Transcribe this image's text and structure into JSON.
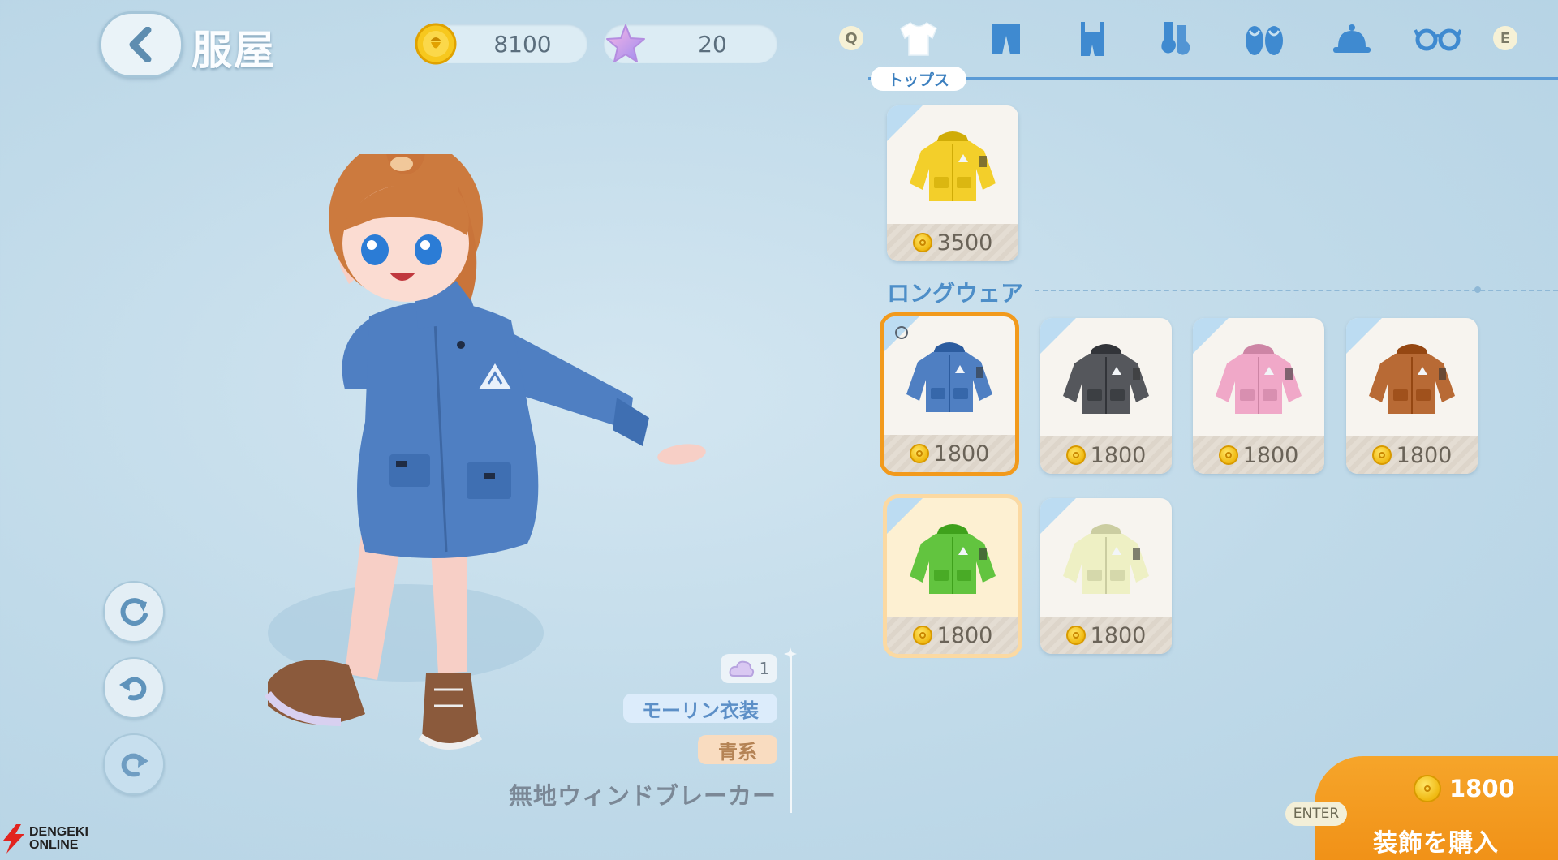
{
  "header": {
    "title": "服屋",
    "coins": "8100",
    "stars": "20"
  },
  "categories": {
    "prev_key": "Q",
    "next_key": "E",
    "active_label": "トップス",
    "icons": [
      "tshirt-icon",
      "pants-icon",
      "overalls-icon",
      "socks-icon",
      "sandals-icon",
      "hat-icon",
      "glasses-icon"
    ]
  },
  "tops": {
    "items": [
      {
        "price": "3500",
        "color": "#f3cf2a"
      }
    ]
  },
  "longwear": {
    "label": "ロングウェア",
    "items": [
      {
        "price": "1800",
        "color": "#4f7fc2",
        "state": "selected"
      },
      {
        "price": "1800",
        "color": "#55575c",
        "state": "normal"
      },
      {
        "price": "1800",
        "color": "#f0a8c8",
        "state": "normal"
      },
      {
        "price": "1800",
        "color": "#b86a35",
        "state": "normal"
      },
      {
        "price": "1800",
        "color": "#62c43f",
        "state": "owned"
      },
      {
        "price": "1800",
        "color": "#eef0c4",
        "state": "normal"
      }
    ]
  },
  "item_info": {
    "count": "1",
    "brand": "モーリン衣装",
    "color_group": "青系",
    "name": "無地ウィンドブレーカー"
  },
  "buy": {
    "price": "1800",
    "label": "装飾を購入",
    "key_hint": "ENTER"
  },
  "watermark": {
    "line1": "DENGEKI",
    "line2": "ONLINE"
  },
  "colors": {
    "accent_orange": "#f29a1c",
    "category_blue": "#5b9bd6",
    "character_jacket": "#4f7fc2"
  }
}
